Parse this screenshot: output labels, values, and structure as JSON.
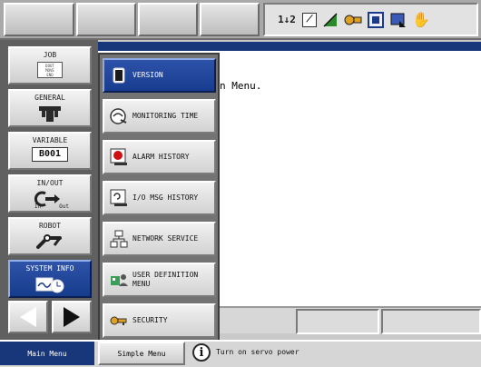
{
  "main_area": {
    "text": "n Menu."
  },
  "status_icons": [
    "1↓2",
    "☒",
    "◢",
    "⛭",
    "▣",
    "▤",
    "✋"
  ],
  "left_menu": {
    "items": [
      {
        "label": "JOB",
        "icon_text": "DOUT\nMOVE\nEND",
        "icon": "job-icon"
      },
      {
        "label": "GENERAL",
        "icon": "general-icon"
      },
      {
        "label": "VARIABLE",
        "icon_text": "B001",
        "icon": "variable-icon"
      },
      {
        "label": "IN/OUT",
        "icon_in": "In",
        "icon_out": "Out",
        "icon": "inout-icon"
      },
      {
        "label": "ROBOT",
        "icon": "robot-icon"
      },
      {
        "label": "SYSTEM INFO",
        "icon": "system-info-icon",
        "active": true
      }
    ]
  },
  "submenu": {
    "items": [
      {
        "label": "VERSION",
        "icon": "version-icon",
        "active": true
      },
      {
        "label": "MONITORING TIME",
        "icon": "monitoring-time-icon"
      },
      {
        "label": "ALARM HISTORY",
        "icon": "alarm-history-icon"
      },
      {
        "label": "I/O MSG HISTORY",
        "icon": "io-msg-history-icon"
      },
      {
        "label": "NETWORK SERVICE",
        "icon": "network-service-icon"
      },
      {
        "label": "USER DEFINITION\nMENU",
        "icon": "user-definition-icon"
      },
      {
        "label": "SECURITY",
        "icon": "security-icon"
      }
    ]
  },
  "bottom_bar": {
    "main_menu": "Main Menu",
    "simple_menu": "Simple Menu",
    "message": "Turn on servo power"
  },
  "colors": {
    "accent": "#17377a",
    "active_button": "#1f4599"
  }
}
